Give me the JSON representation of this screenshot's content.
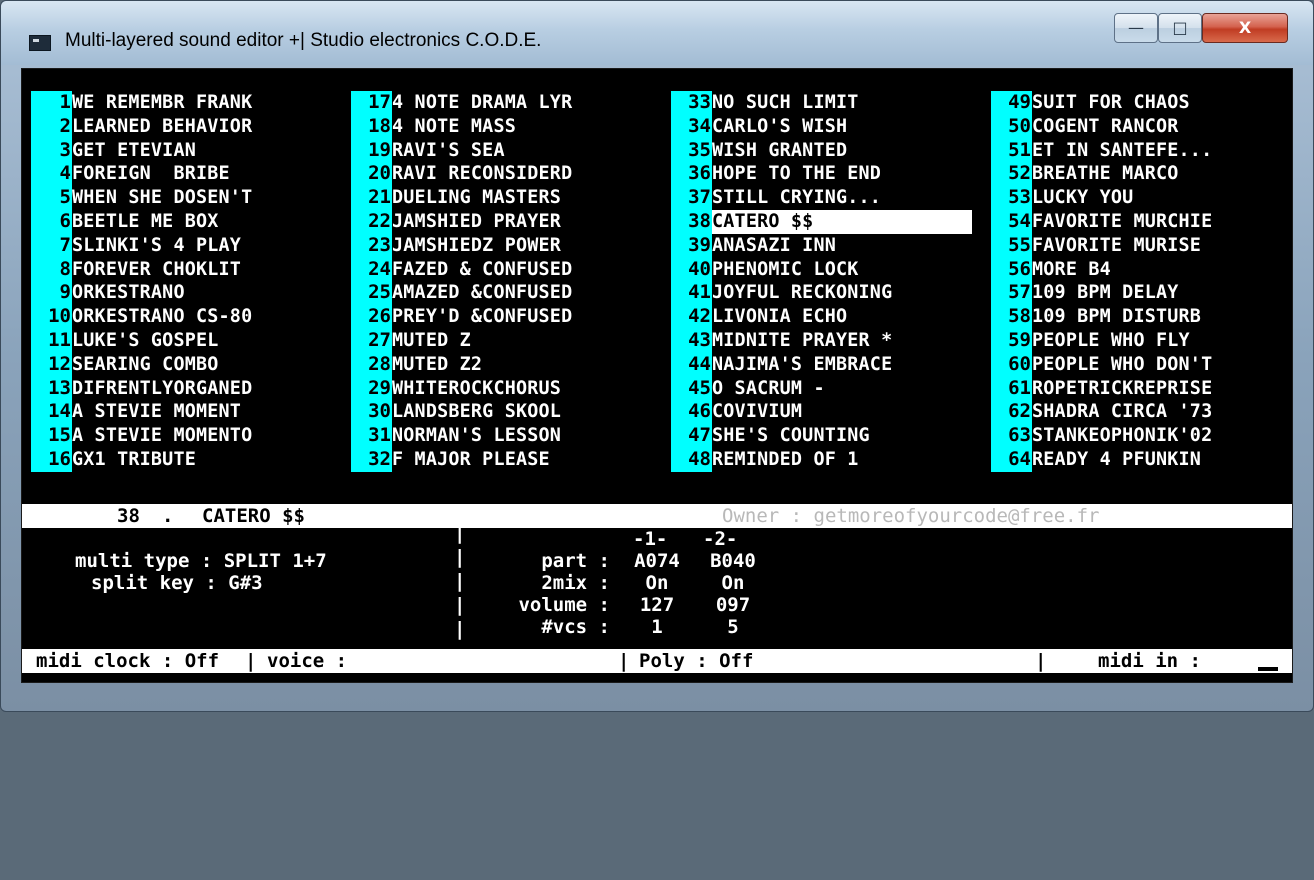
{
  "window": {
    "title": "Multi-layered sound editor +| Studio electronics C.O.D.E.",
    "buttons": {
      "minimize": "—",
      "maximize": "□",
      "close": "X"
    }
  },
  "programs": [
    [
      {
        "n": "1",
        "name": "WE REMEMBR FRANK"
      },
      {
        "n": "2",
        "name": "LEARNED BEHAVIOR"
      },
      {
        "n": "3",
        "name": "GET ETEVIAN"
      },
      {
        "n": "4",
        "name": "FOREIGN  BRIBE"
      },
      {
        "n": "5",
        "name": "WHEN SHE DOSEN'T"
      },
      {
        "n": "6",
        "name": "BEETLE ME BOX"
      },
      {
        "n": "7",
        "name": "SLINKI'S 4 PLAY"
      },
      {
        "n": "8",
        "name": "FOREVER CHOKLIT"
      },
      {
        "n": "9",
        "name": "ORKESTRANO"
      },
      {
        "n": "10",
        "name": "ORKESTRANO CS-80"
      },
      {
        "n": "11",
        "name": "LUKE'S GOSPEL"
      },
      {
        "n": "12",
        "name": "SEARING COMBO"
      },
      {
        "n": "13",
        "name": "DIFRENTLYORGANED"
      },
      {
        "n": "14",
        "name": "A STEVIE MOMENT"
      },
      {
        "n": "15",
        "name": "A STEVIE MOMENTO"
      },
      {
        "n": "16",
        "name": "GX1 TRIBUTE"
      }
    ],
    [
      {
        "n": "17",
        "name": "4 NOTE DRAMA LYR"
      },
      {
        "n": "18",
        "name": "4 NOTE MASS"
      },
      {
        "n": "19",
        "name": "RAVI'S SEA"
      },
      {
        "n": "20",
        "name": "RAVI RECONSIDERD"
      },
      {
        "n": "21",
        "name": "DUELING MASTERS"
      },
      {
        "n": "22",
        "name": "JAMSHIED PRAYER"
      },
      {
        "n": "23",
        "name": "JAMSHIEDZ POWER"
      },
      {
        "n": "24",
        "name": "FAZED & CONFUSED"
      },
      {
        "n": "25",
        "name": "AMAZED &CONFUSED"
      },
      {
        "n": "26",
        "name": "PREY'D &CONFUSED"
      },
      {
        "n": "27",
        "name": "MUTED Z"
      },
      {
        "n": "28",
        "name": "MUTED Z2"
      },
      {
        "n": "29",
        "name": "WHITEROCKCHORUS"
      },
      {
        "n": "30",
        "name": "LANDSBERG SKOOL"
      },
      {
        "n": "31",
        "name": "NORMAN'S LESSON"
      },
      {
        "n": "32",
        "name": "F MAJOR PLEASE"
      }
    ],
    [
      {
        "n": "33",
        "name": "NO SUCH LIMIT"
      },
      {
        "n": "34",
        "name": "CARLO'S WISH"
      },
      {
        "n": "35",
        "name": "WISH GRANTED"
      },
      {
        "n": "36",
        "name": "HOPE TO THE END"
      },
      {
        "n": "37",
        "name": "STILL CRYING..."
      },
      {
        "n": "38",
        "name": "CATERO $$",
        "selected": true
      },
      {
        "n": "39",
        "name": "ANASAZI INN"
      },
      {
        "n": "40",
        "name": "PHENOMIC LOCK"
      },
      {
        "n": "41",
        "name": "JOYFUL RECKONING"
      },
      {
        "n": "42",
        "name": "LIVONIA ECHO"
      },
      {
        "n": "43",
        "name": "MIDNITE PRAYER *"
      },
      {
        "n": "44",
        "name": "NAJIMA'S EMBRACE"
      },
      {
        "n": "45",
        "name": "O SACRUM -"
      },
      {
        "n": "46",
        "name": "COVIVIUM"
      },
      {
        "n": "47",
        "name": "SHE'S COUNTING"
      },
      {
        "n": "48",
        "name": "REMINDED OF 1"
      }
    ],
    [
      {
        "n": "49",
        "name": "SUIT FOR CHAOS"
      },
      {
        "n": "50",
        "name": "COGENT RANCOR"
      },
      {
        "n": "51",
        "name": "ET IN SANTEFE..."
      },
      {
        "n": "52",
        "name": "BREATHE MARCO"
      },
      {
        "n": "53",
        "name": "LUCKY YOU"
      },
      {
        "n": "54",
        "name": "FAVORITE MURCHIE"
      },
      {
        "n": "55",
        "name": "FAVORITE MURISE"
      },
      {
        "n": "56",
        "name": "MORE B4"
      },
      {
        "n": "57",
        "name": "109 BPM DELAY"
      },
      {
        "n": "58",
        "name": "109 BPM DISTURB"
      },
      {
        "n": "59",
        "name": "PEOPLE WHO FLY"
      },
      {
        "n": "60",
        "name": "PEOPLE WHO DON'T"
      },
      {
        "n": "61",
        "name": "ROPETRICKREPRISE"
      },
      {
        "n": "62",
        "name": "SHADRA CIRCA '73"
      },
      {
        "n": "63",
        "name": "STANKEOPHONIK'02"
      },
      {
        "n": "64",
        "name": "READY 4 PFUNKIN"
      }
    ]
  ],
  "status": {
    "program_number": "38",
    "dot": ".",
    "program_name": "CATERO $$",
    "owner": "Owner : getmoreofyourcode@free.fr"
  },
  "params": {
    "multi_type_line": "multi type : SPLIT 1+7",
    "split_key_line": "split key : G#3",
    "col_header_1": "-1-",
    "col_header_2": "-2-",
    "rows": [
      {
        "label": "part :",
        "v1": "A074",
        "v2": "B040"
      },
      {
        "label": "2mix :",
        "v1": "On",
        "v2": "On"
      },
      {
        "label": "volume :",
        "v1": "127",
        "v2": "097"
      },
      {
        "label": "#vcs :",
        "v1": "1",
        "v2": "5"
      }
    ],
    "sep": "|"
  },
  "bottom": {
    "midi_clock": "midi clock : Off",
    "voice": "voice :",
    "poly": "Poly : Off",
    "midi_in": "midi in :",
    "sep": "|"
  }
}
